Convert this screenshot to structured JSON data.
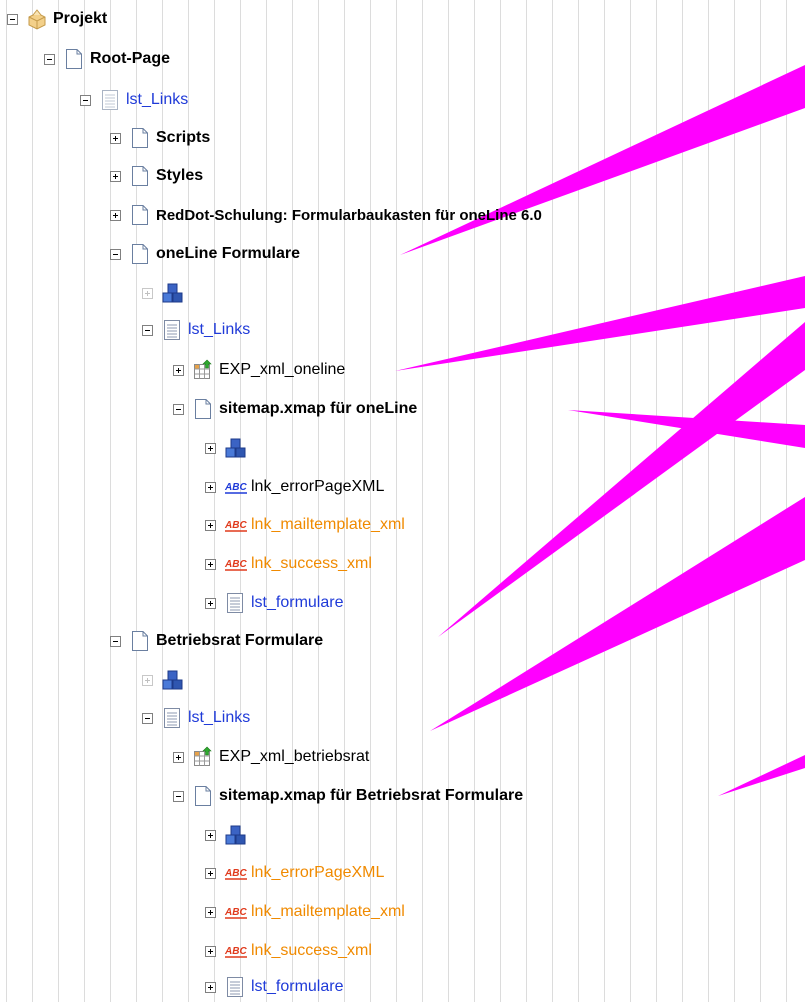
{
  "tree": {
    "root": {
      "label": "Projekt",
      "icon": "folder-icon"
    },
    "items": [
      {
        "label": "Root-Page",
        "icon": "page-icon"
      },
      {
        "label": "lst_Links",
        "icon": "list-icon"
      },
      {
        "label": "Scripts",
        "icon": "page-icon"
      },
      {
        "label": "Styles",
        "icon": "page-icon"
      },
      {
        "label": "RedDot-Schulung: Formularbaukasten für oneLine 6.0",
        "icon": "page-icon"
      },
      {
        "label": "oneLine Formulare",
        "icon": "page-icon"
      },
      {
        "label": "lst_Links",
        "icon": "list-icon"
      },
      {
        "label": "EXP_xml_oneline",
        "icon": "export-table-icon"
      },
      {
        "label": "sitemap.xmap für oneLine",
        "icon": "page-icon"
      },
      {
        "label": "lnk_errorPageXML",
        "icon": "abc-link-icon"
      },
      {
        "label": "lnk_mailtemplate_xml",
        "icon": "abc-link-icon"
      },
      {
        "label": "lnk_success_xml",
        "icon": "abc-link-icon"
      },
      {
        "label": "lst_formulare",
        "icon": "list-icon"
      },
      {
        "label": "Betriebsrat Formulare",
        "icon": "page-icon"
      },
      {
        "label": "lst_Links",
        "icon": "list-icon"
      },
      {
        "label": "EXP_xml_betriebsrat",
        "icon": "export-table-icon"
      },
      {
        "label": "sitemap.xmap für Betriebsrat Formulare",
        "icon": "page-icon"
      },
      {
        "label": "lnk_errorPageXML",
        "icon": "abc-link-icon"
      },
      {
        "label": "lnk_mailtemplate_xml",
        "icon": "abc-link-icon"
      },
      {
        "label": "lnk_success_xml",
        "icon": "abc-link-icon"
      },
      {
        "label": "lst_formulare",
        "icon": "list-icon"
      }
    ],
    "element_icons": [
      "cubes-icon",
      "cubes-icon",
      "cubes-icon",
      "cubes-icon"
    ]
  },
  "colors": {
    "page_bold_text": "#000000",
    "list_text": "#1f3ad8",
    "orange_link_text": "#f08a00",
    "annotation_arrows": "#ff00ff",
    "grid_lines": "#dcdcdc"
  }
}
